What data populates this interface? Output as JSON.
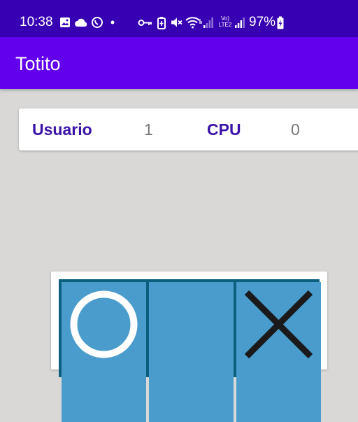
{
  "status_bar": {
    "time": "10:38",
    "battery_percent": "97%",
    "left_icons": [
      "gallery-icon",
      "cloud-icon",
      "whatsapp-icon",
      "dot-icon"
    ],
    "right_icons": [
      "key-icon",
      "battery-saver-icon",
      "mute-icon",
      "wifi-icon",
      "signal-icon",
      "volte-lte2-icon",
      "signal-icon",
      "battery-charging-icon"
    ],
    "volte_label": "Vo)",
    "lte_label": "LTE2"
  },
  "app_bar": {
    "title": "Totito"
  },
  "score": {
    "user_label": "Usuario",
    "user_score": "1",
    "cpu_label": "CPU",
    "cpu_score": "0"
  },
  "board": {
    "cells": [
      "O",
      "",
      "X"
    ]
  },
  "colors": {
    "status_bar": "#3700b3",
    "app_bar": "#6200ee",
    "background": "#d9d8d7",
    "score_label": "#3b12a8",
    "board_border": "#0d5f7f",
    "cell": "#4a9ccc",
    "x_mark": "#1a1a1a",
    "o_mark": "#ffffff"
  }
}
